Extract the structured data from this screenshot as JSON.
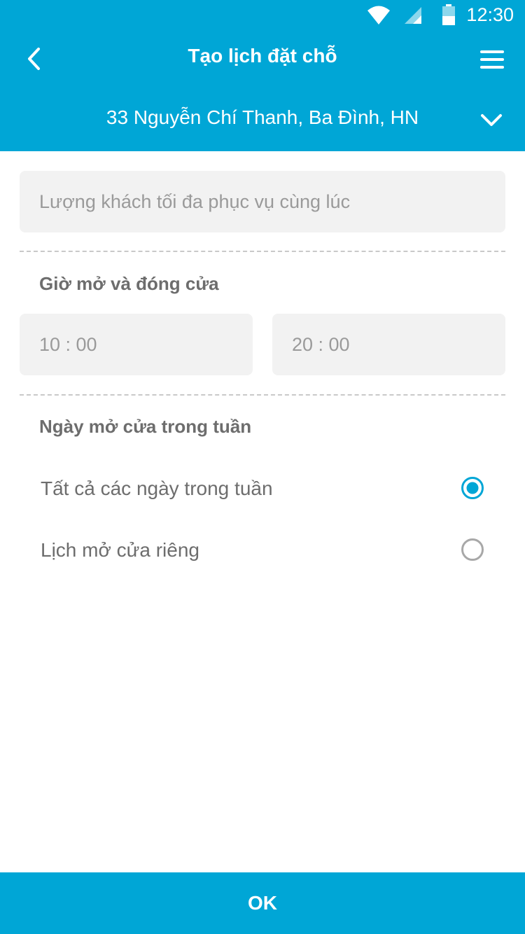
{
  "status_bar": {
    "time": "12:30",
    "icons": [
      "wifi-icon",
      "signal-icon",
      "battery-icon"
    ]
  },
  "header": {
    "title": "Tạo lịch đặt chỗ",
    "back_icon": "chevron-left-icon",
    "menu_icon": "hamburger-menu-icon",
    "address": "33 Nguyễn Chí Thanh, Ba Đình, HN",
    "address_dropdown_icon": "chevron-down-icon"
  },
  "form": {
    "capacity_placeholder": "Lượng khách tối đa phục vụ cùng lúc",
    "hours_label": "Giờ mở và đóng cửa",
    "open_time": "10 : 00",
    "close_time": "20 : 00",
    "days_label": "Ngày mở cửa trong tuần",
    "day_options": [
      {
        "label": "Tất cả các ngày trong tuần",
        "selected": true
      },
      {
        "label": "Lịch mở cửa riêng",
        "selected": false
      }
    ]
  },
  "footer": {
    "ok_label": "OK"
  },
  "colors": {
    "primary": "#00a6d6",
    "input_bg": "#f2f2f2",
    "label_text": "#6d6d6d",
    "placeholder_text": "#9a9a9a",
    "radio_unselected": "#a8a8a8"
  }
}
